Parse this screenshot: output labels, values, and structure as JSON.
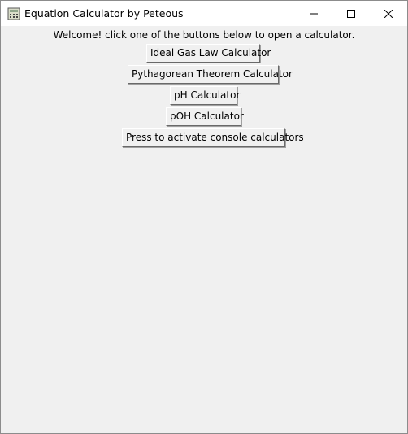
{
  "window": {
    "title": "Equation Calculator by Peteous",
    "icon": "calculator-icon",
    "controls": {
      "minimize_icon": "minimize-icon",
      "maximize_icon": "maximize-icon",
      "close_icon": "close-icon"
    }
  },
  "main": {
    "welcome_text": "Welcome! click one of the buttons below to open a calculator.",
    "buttons": [
      {
        "label": "Ideal Gas Law Calculator"
      },
      {
        "label": "Pythagorean Theorem Calculator"
      },
      {
        "label": "pH Calculator"
      },
      {
        "label": "pOH Calculator"
      },
      {
        "label": "Press to activate console calculators"
      }
    ]
  },
  "colors": {
    "window_background": "#f0f0f0",
    "titlebar_background": "#ffffff",
    "text": "#000000"
  }
}
